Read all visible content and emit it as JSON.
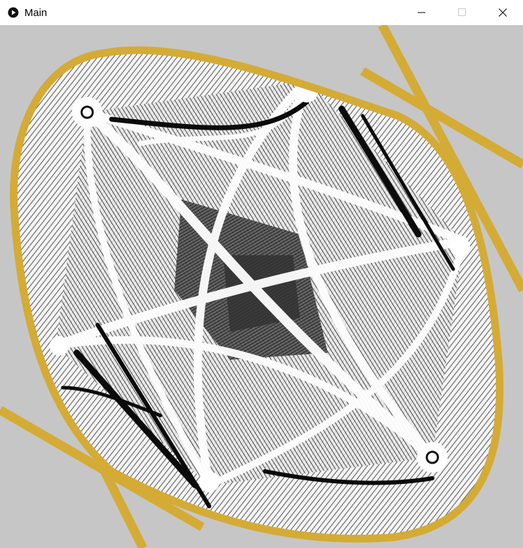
{
  "window": {
    "title": "Main",
    "icons": {
      "app": "play-circle-icon",
      "minimize": "minimize-icon",
      "maximize": "maximize-icon",
      "close": "close-icon"
    }
  },
  "canvas": {
    "description_colors": {
      "background": "#c6c6c6",
      "boundary": "#d4ab35",
      "pattern_dark": "#111111",
      "pattern_light": "#ffffff"
    }
  }
}
